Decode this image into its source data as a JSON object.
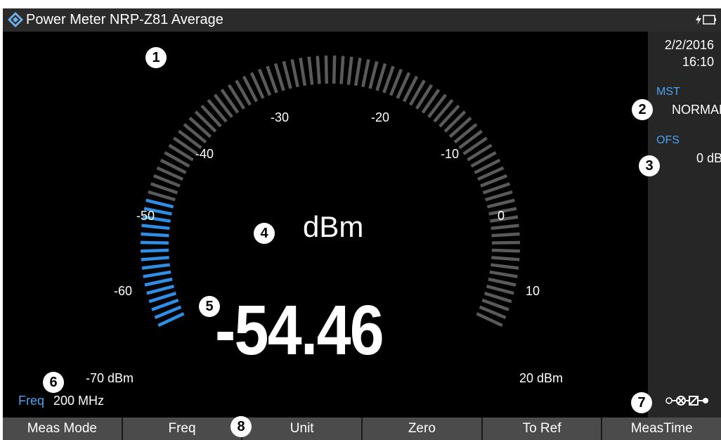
{
  "titlebar": {
    "title": "Power Meter NRP-Z81 Average",
    "logo_icon": "rs-diamond-logo-icon",
    "status_icon": "battery-charging-icon"
  },
  "sidepanel": {
    "date": "2/2/2016",
    "time": "16:10",
    "mst_label": "MST",
    "mst_value": "NORMAL",
    "ofs_label": "OFS",
    "ofs_value": "0 dB",
    "connection_icon": "sensor-connection-icon"
  },
  "gauge": {
    "unit": "dBm",
    "reading": "-54.46",
    "reading_value": -54.46,
    "scale_min": -70,
    "scale_max": 20,
    "active_color": "#2f8fe6",
    "inactive_color": "#5a5a5a",
    "tick_labels": [
      "-70 dBm",
      "-60",
      "-50",
      "-40",
      "-30",
      "-20",
      "-10",
      "0",
      "10",
      "20 dBm"
    ]
  },
  "freq": {
    "label": "Freq",
    "value": "200 MHz"
  },
  "callouts": [
    "1",
    "2",
    "3",
    "4",
    "5",
    "6",
    "7",
    "8"
  ],
  "softkeys": [
    "Meas Mode",
    "Freq",
    "Unit",
    "Zero",
    "To Ref",
    "MeasTime"
  ],
  "colors": {
    "accent_label": "#4ba3f0",
    "softkey_bg": "#4b4b4b",
    "titlebar_bg": "#2b2b2b"
  }
}
